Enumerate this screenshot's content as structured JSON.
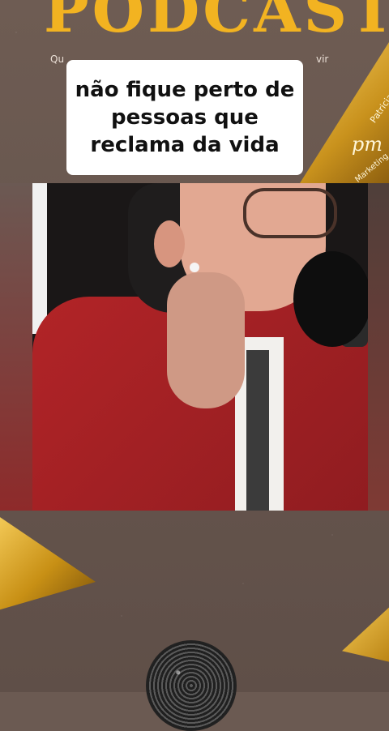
{
  "header": {
    "title": "PODCAST",
    "subtitle_left": "Qu",
    "subtitle_right": "vir"
  },
  "caption": {
    "line1": "não fique perto de",
    "line2": "pessoas que",
    "line3": "reclama da vida"
  },
  "logo": {
    "name": "Patricia M",
    "mark": "pm",
    "tagline": "Marketing"
  },
  "colors": {
    "background": "#6b5a52",
    "accent": "#f2b321",
    "caption_bg": "#ffffff"
  }
}
